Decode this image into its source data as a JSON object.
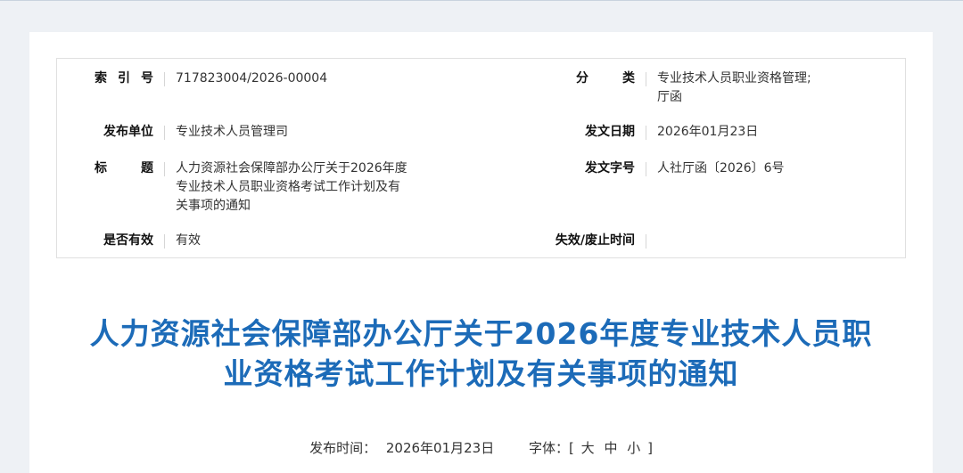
{
  "meta": {
    "index_label": [
      "索",
      "引",
      "号"
    ],
    "index_value": "717823004/2026-00004",
    "category_label": [
      "分",
      "类"
    ],
    "category_value_line1": "专业技术人员职业资格管理;",
    "category_value_line2": "厅函",
    "publisher_label": "发布单位",
    "publisher_value": "专业技术人员管理司",
    "issue_date_label": "发文日期",
    "issue_date_value": "2026年01月23日",
    "title_label": [
      "标",
      "题"
    ],
    "title_value_line1": "人力资源社会保障部办公厅关于2026年度",
    "title_value_line2": "专业技术人员职业资格考试工作计划及有",
    "title_value_line3": "关事项的通知",
    "doc_number_label": "发文字号",
    "doc_number_value": "人社厅函〔2026〕6号",
    "valid_label": "是否有效",
    "valid_value": "有效",
    "expiry_label": "失效/废止时间",
    "expiry_value": ""
  },
  "article": {
    "title_line1": "人力资源社会保障部办公厅关于2026年度专业技术人员职",
    "title_line2": "业资格考试工作计划及有关事项的通知"
  },
  "publish": {
    "time_label": "发布时间：",
    "time_value": "2026年01月23日",
    "font_label": "字体：",
    "bracket_open": "[",
    "large": "大",
    "medium": "中",
    "small": "小",
    "bracket_close": "]"
  },
  "colors": {
    "title": "#1c6bb8",
    "background": "#eef1f5"
  }
}
